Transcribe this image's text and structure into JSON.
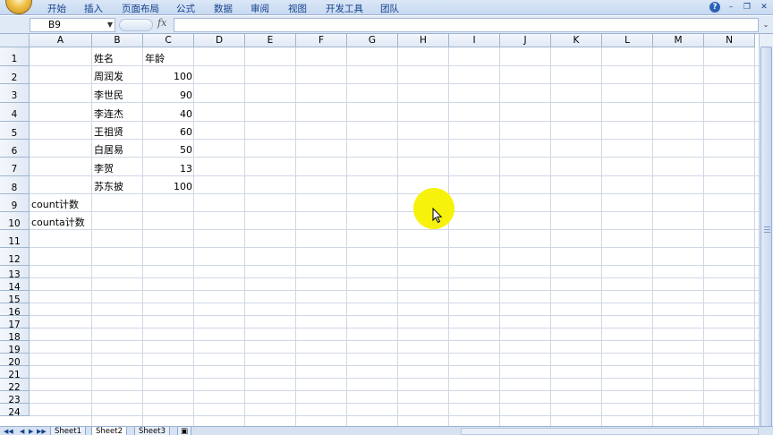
{
  "ribbon": {
    "tabs": [
      "开始",
      "插入",
      "页面布局",
      "公式",
      "数据",
      "审阅",
      "视图",
      "开发工具",
      "团队"
    ]
  },
  "formula_bar": {
    "name_box": "B9",
    "fx_label": "fx",
    "formula": ""
  },
  "columns": [
    "A",
    "B",
    "C",
    "D",
    "E",
    "F",
    "G",
    "H",
    "I",
    "J",
    "K",
    "L",
    "M",
    "N"
  ],
  "rows": [
    "1",
    "2",
    "3",
    "4",
    "5",
    "6",
    "7",
    "8",
    "9",
    "10",
    "11",
    "12",
    "13",
    "14",
    "15",
    "16",
    "17",
    "18",
    "19",
    "20",
    "21",
    "22",
    "23",
    "24"
  ],
  "cells": {
    "B1": "姓名",
    "C1": "年龄",
    "B2": "周润发",
    "C2": "100",
    "B3": "李世民",
    "C3": "90",
    "B4": "李连杰",
    "C4": "40",
    "B5": "王祖贤",
    "C5": "60",
    "B6": "白居易",
    "C6": "50",
    "B7": "李贺",
    "C7": "13",
    "B8": "苏东披",
    "C8": "100",
    "A9": "count计数",
    "A10": "counta计数"
  },
  "sheets": [
    "Sheet1",
    "Sheet2",
    "Sheet3"
  ],
  "active_sheet": "Sheet2",
  "colors": {
    "ribbon_text": "#15428b",
    "cursor_highlight": "#f7f20c"
  }
}
